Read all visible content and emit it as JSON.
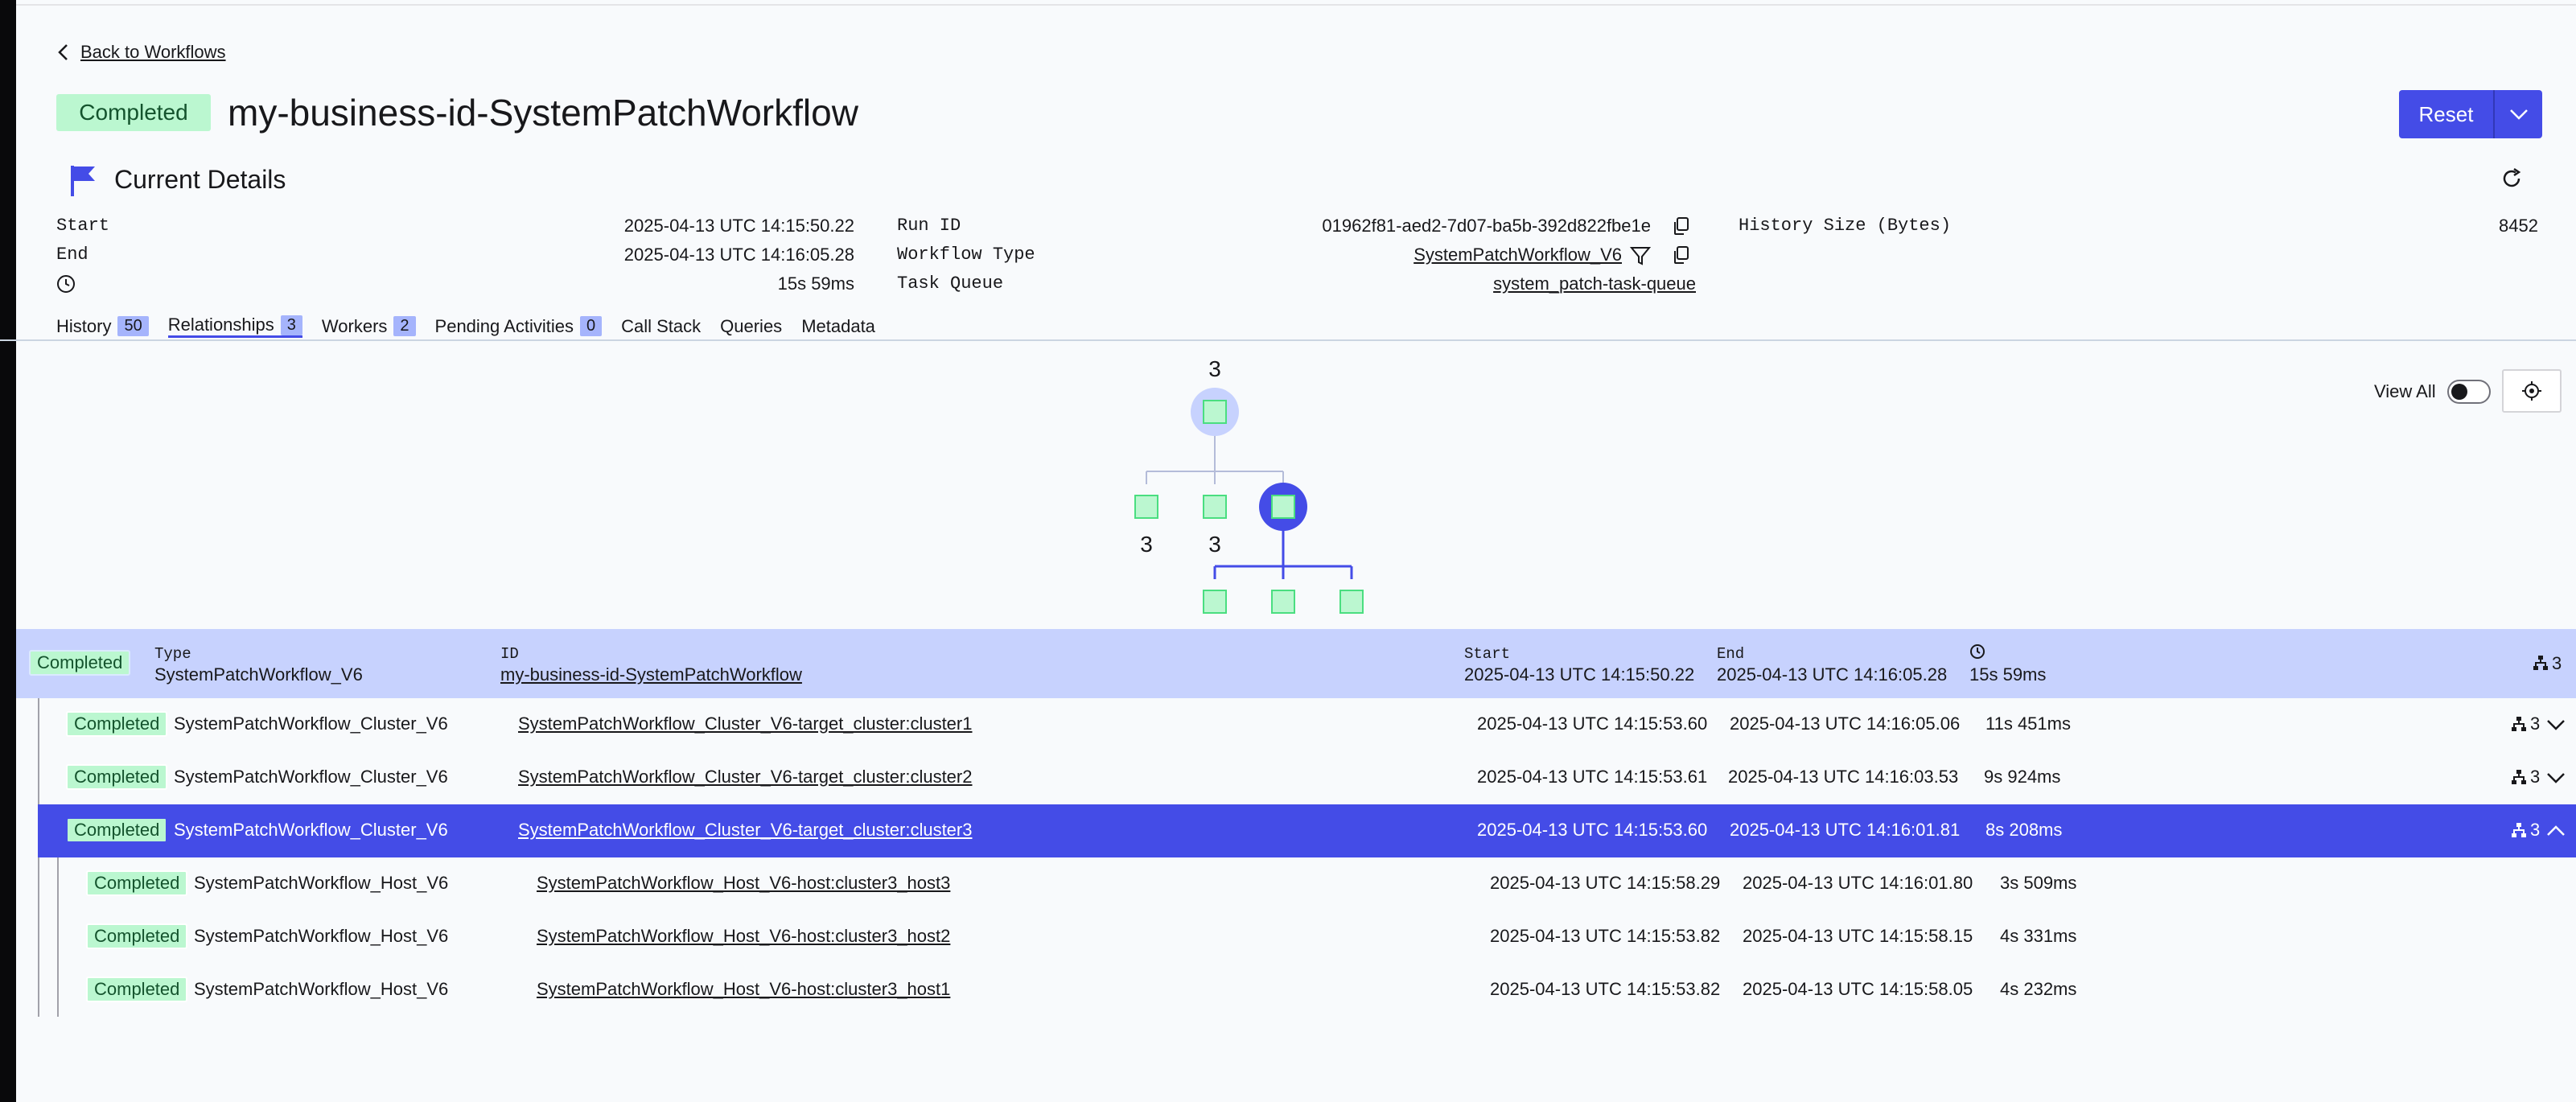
{
  "nav": {
    "back_label": "Back to Workflows"
  },
  "header": {
    "status": "Completed",
    "title": "my-business-id-SystemPatchWorkflow",
    "reset_label": "Reset"
  },
  "details": {
    "title": "Current Details",
    "start_label": "Start",
    "start_value": "2025-04-13 UTC 14:15:50.22",
    "end_label": "End",
    "end_value": "2025-04-13 UTC 14:16:05.28",
    "duration_value": "15s 59ms",
    "run_id_label": "Run ID",
    "run_id_value": "01962f81-aed2-7d07-ba5b-392d822fbe1e",
    "workflow_type_label": "Workflow Type",
    "workflow_type_value": "SystemPatchWorkflow_V6",
    "task_queue_label": "Task Queue",
    "task_queue_value": "system_patch-task-queue",
    "history_size_label": "History Size (Bytes)",
    "history_size_value": "8452"
  },
  "tabs": [
    {
      "label": "History",
      "count": "50"
    },
    {
      "label": "Relationships",
      "count": "3"
    },
    {
      "label": "Workers",
      "count": "2"
    },
    {
      "label": "Pending Activities",
      "count": "0"
    },
    {
      "label": "Call Stack",
      "count": null
    },
    {
      "label": "Queries",
      "count": null
    },
    {
      "label": "Metadata",
      "count": null
    }
  ],
  "graph": {
    "view_all_label": "View All",
    "root_count": "3",
    "child1_count": "3",
    "child2_count": "3"
  },
  "colors": {
    "accent": "#444ce7",
    "completed_bg": "#bbf7d0",
    "root_row_bg": "#c7d2fe"
  },
  "table": {
    "root": {
      "status": "Completed",
      "type_label": "Type",
      "type": "SystemPatchWorkflow_V6",
      "id_label": "ID",
      "id": "my-business-id-SystemPatchWorkflow",
      "start_label": "Start",
      "start": "2025-04-13 UTC 14:15:50.22",
      "end_label": "End",
      "end": "2025-04-13 UTC 14:16:05.28",
      "duration": "15s 59ms",
      "children_count": "3"
    },
    "clusters": [
      {
        "status": "Completed",
        "type": "SystemPatchWorkflow_Cluster_V6",
        "id": "SystemPatchWorkflow_Cluster_V6-target_cluster:cluster1",
        "start": "2025-04-13 UTC 14:15:53.60",
        "end": "2025-04-13 UTC 14:16:05.06",
        "duration": "11s 451ms",
        "children_count": "3"
      },
      {
        "status": "Completed",
        "type": "SystemPatchWorkflow_Cluster_V6",
        "id": "SystemPatchWorkflow_Cluster_V6-target_cluster:cluster2",
        "start": "2025-04-13 UTC 14:15:53.61",
        "end": "2025-04-13 UTC 14:16:03.53",
        "duration": "9s 924ms",
        "children_count": "3"
      },
      {
        "status": "Completed",
        "type": "SystemPatchWorkflow_Cluster_V6",
        "id": "SystemPatchWorkflow_Cluster_V6-target_cluster:cluster3",
        "start": "2025-04-13 UTC 14:15:53.60",
        "end": "2025-04-13 UTC 14:16:01.81",
        "duration": "8s 208ms",
        "children_count": "3"
      }
    ],
    "hosts": [
      {
        "status": "Completed",
        "type": "SystemPatchWorkflow_Host_V6",
        "id": "SystemPatchWorkflow_Host_V6-host:cluster3_host3",
        "start": "2025-04-13 UTC 14:15:58.29",
        "end": "2025-04-13 UTC 14:16:01.80",
        "duration": "3s 509ms"
      },
      {
        "status": "Completed",
        "type": "SystemPatchWorkflow_Host_V6",
        "id": "SystemPatchWorkflow_Host_V6-host:cluster3_host2",
        "start": "2025-04-13 UTC 14:15:53.82",
        "end": "2025-04-13 UTC 14:15:58.15",
        "duration": "4s 331ms"
      },
      {
        "status": "Completed",
        "type": "SystemPatchWorkflow_Host_V6",
        "id": "SystemPatchWorkflow_Host_V6-host:cluster3_host1",
        "start": "2025-04-13 UTC 14:15:53.82",
        "end": "2025-04-13 UTC 14:15:58.05",
        "duration": "4s 232ms"
      }
    ]
  }
}
